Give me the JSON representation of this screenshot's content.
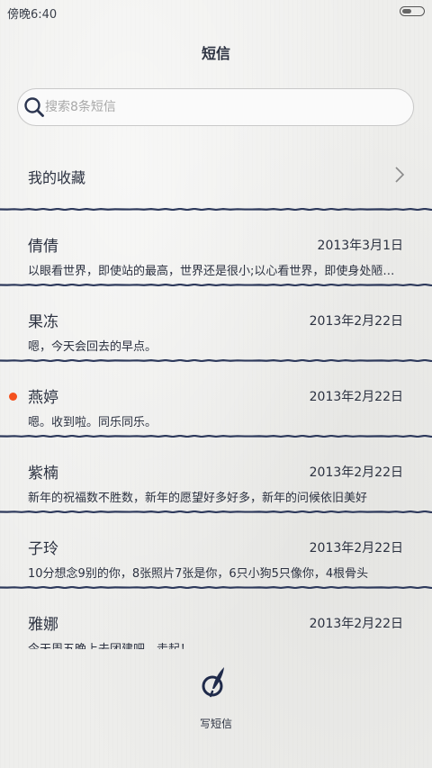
{
  "status_bar": {
    "time": "傍晚6:40"
  },
  "header": {
    "title": "短信"
  },
  "search": {
    "placeholder": "搜索8条短信"
  },
  "favorites": {
    "label": "我的收藏"
  },
  "messages": [
    {
      "name": "倩倩",
      "date": "2013年3月1日",
      "preview": "以眼看世界，即使站的最高，世界还是很小;以心看世界，即使身处陋室，世界也是很大",
      "unread": false
    },
    {
      "name": "果冻",
      "date": "2013年2月22日",
      "preview": "嗯，今天会回去的早点。",
      "unread": false
    },
    {
      "name": "燕婷",
      "date": "2013年2月22日",
      "preview": "嗯。收到啦。同乐同乐。",
      "unread": true
    },
    {
      "name": "紫楠",
      "date": "2013年2月22日",
      "preview": "新年的祝福数不胜数，新年的愿望好多好多，新年的问候依旧美好",
      "unread": false
    },
    {
      "name": "子玲",
      "date": "2013年2月22日",
      "preview": "10分想念9别的你，8张照片7张是你，6只小狗5只像你，4根骨头",
      "unread": false
    },
    {
      "name": "雅娜",
      "date": "2013年2月22日",
      "preview": "今天周五晚上去团建吧，走起！",
      "unread": false
    }
  ],
  "compose": {
    "label": "写短信"
  },
  "colors": {
    "ink": "#2b3140",
    "unread": "#f4511e",
    "divider": "#2e3a5c"
  }
}
